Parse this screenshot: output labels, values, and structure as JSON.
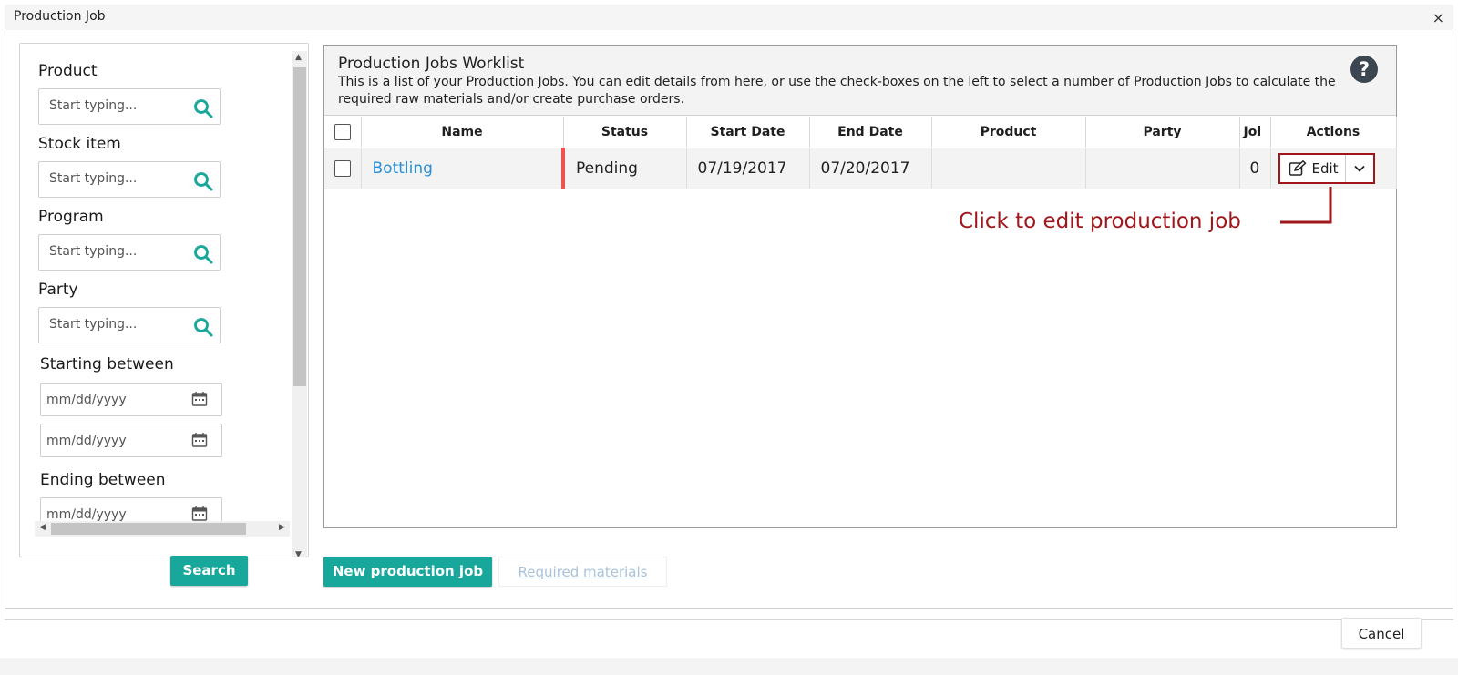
{
  "window": {
    "title": "Production Job",
    "close_glyph": "×"
  },
  "filters": {
    "product_label": "Product",
    "product_placeholder": "Start typing...",
    "stock_label": "Stock item",
    "stock_placeholder": "Start typing...",
    "program_label": "Program",
    "program_placeholder": "Start typing...",
    "party_label": "Party",
    "party_placeholder": "Start typing...",
    "starting_label": "Starting between",
    "starting_from": "mm/dd/yyyy",
    "starting_to": "mm/dd/yyyy",
    "ending_label": "Ending between",
    "ending_from": "mm/dd/yyyy",
    "search_button": "Search"
  },
  "worklist": {
    "title": "Production Jobs Worklist",
    "description": "This is a list of your Production Jobs. You can edit details from here, or use the check-boxes on the left to select a number of Production Jobs to calculate the required raw materials and/or create purchase orders.",
    "help_glyph": "?",
    "columns": [
      "Name",
      "Status",
      "Start Date",
      "End Date",
      "Product",
      "Party",
      "Jol",
      "Actions"
    ],
    "rows": [
      {
        "name": "Bottling",
        "status": "Pending",
        "start": "07/19/2017",
        "end": "07/20/2017",
        "product": "",
        "party": "",
        "jobs": "0",
        "edit": "Edit"
      }
    ],
    "status_color": "#ef5350"
  },
  "callout": {
    "text": "Click to edit production job",
    "color": "#a0161a"
  },
  "actions": {
    "new_job": "New production job",
    "required_materials": "Required materials",
    "cancel": "Cancel"
  },
  "colors": {
    "accent": "#17a89b",
    "link": "#2a8fd6",
    "icon_teal": "#17a89b"
  }
}
